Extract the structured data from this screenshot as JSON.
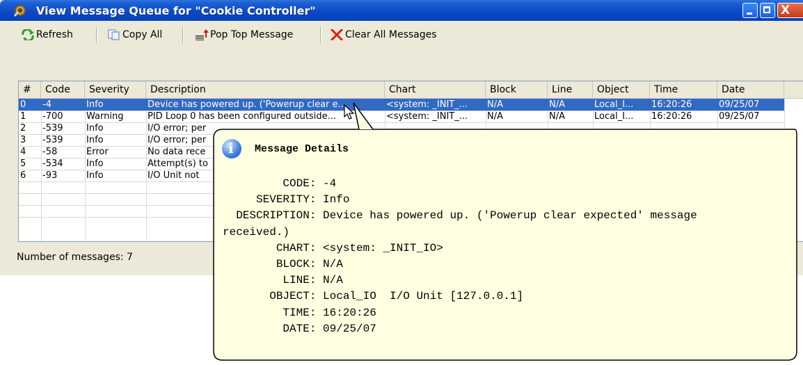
{
  "window": {
    "title": "View Message Queue for \"Cookie Controller\"",
    "close_glyph": "X"
  },
  "toolbar": {
    "refresh": "Refresh",
    "copy_all": "Copy All",
    "pop_top": "Pop Top Message",
    "clear_all": "Clear All Messages"
  },
  "table": {
    "columns": [
      "#",
      "Code",
      "Severity",
      "Description",
      "Chart",
      "Block",
      "Line",
      "Object",
      "Time",
      "Date"
    ],
    "rows": [
      [
        "0",
        "-4",
        "Info",
        "Device has powered up. ('Powerup clear e...",
        "<system:  _INIT_...",
        "N/A",
        "N/A",
        "Local_I...",
        "16:20:26",
        "09/25/07"
      ],
      [
        "1",
        "-700",
        "Warning",
        "PID Loop 0 has been configured outside...",
        "<system:  _INIT_...",
        "N/A",
        "N/A",
        "Local_I...",
        "16:20:26",
        "09/25/07"
      ],
      [
        "2",
        "-539",
        "Info",
        "I/O error; per",
        "",
        "",
        "",
        "",
        "",
        ""
      ],
      [
        "3",
        "-539",
        "Info",
        "I/O error; per",
        "",
        "",
        "",
        "",
        "",
        ""
      ],
      [
        "4",
        "-58",
        "Error",
        "No data rece",
        "",
        "",
        "",
        "",
        "",
        ""
      ],
      [
        "5",
        "-534",
        "Info",
        "Attempt(s) to",
        "",
        "",
        "",
        "",
        "",
        ""
      ],
      [
        "6",
        "-93",
        "Info",
        "I/O Unit not",
        "",
        "",
        "",
        "",
        "",
        ""
      ]
    ],
    "selected_index": 0
  },
  "status": {
    "text": "Number of messages: 7"
  },
  "tooltip": {
    "title": "Message Details",
    "body": "         CODE: -4\n     SEVERITY: Info\n  DESCRIPTION: Device has powered up. ('Powerup clear expected' message\nreceived.)\n        CHART: <system: _INIT_IO>\n        BLOCK: N/A\n         LINE: N/A\n       OBJECT: Local_IO  I/O Unit [127.0.0.1]\n         TIME: 16:20:26\n         DATE: 09/25/07"
  },
  "colors": {
    "titlebar": "#0a49c6",
    "selection": "#316ac5",
    "tooltip_bg": "#ffffe1"
  }
}
